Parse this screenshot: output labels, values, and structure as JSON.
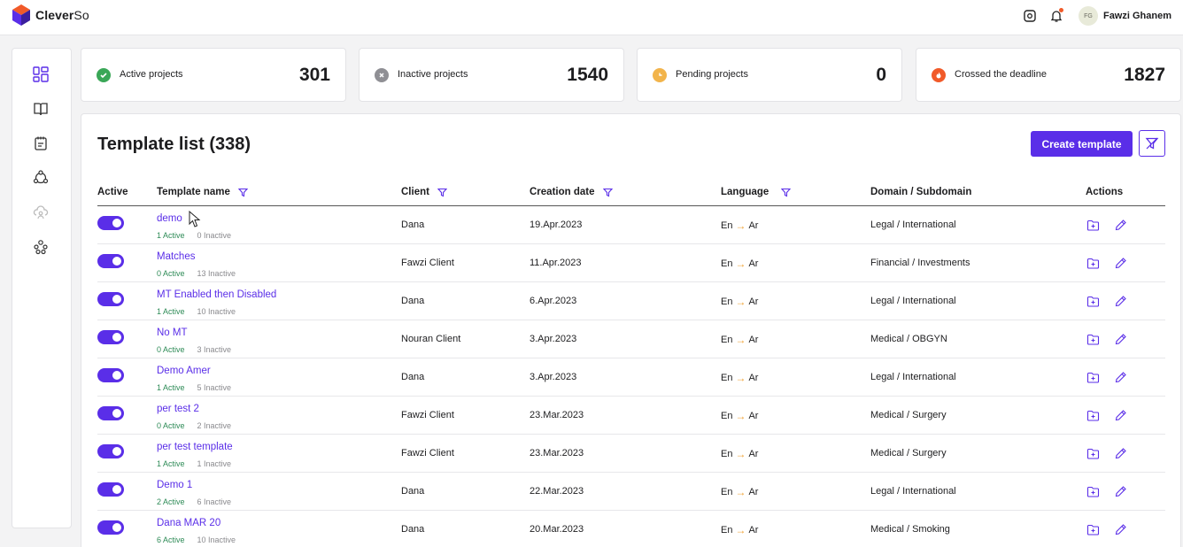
{
  "app": {
    "brand_bold": "Clever",
    "brand_light": "So"
  },
  "user": {
    "initials": "FG",
    "name": "Fawzi Ghanem"
  },
  "header_icons": [
    "settings-cog-icon",
    "bell-icon"
  ],
  "sidebar": {
    "items": [
      "dashboard-icon",
      "book-icon",
      "notebook-icon",
      "network-icon",
      "cloud-user-icon",
      "team-icon"
    ]
  },
  "stats": [
    {
      "label": "Active projects",
      "value": "301",
      "icon": "check-circle-icon",
      "color": "#3aa757"
    },
    {
      "label": "Inactive projects",
      "value": "1540",
      "icon": "x-circle-icon",
      "color": "#8f8f94"
    },
    {
      "label": "Pending projects",
      "value": "0",
      "icon": "clock-icon",
      "color": "#f2b44b"
    },
    {
      "label": "Crossed the deadline",
      "value": "1827",
      "icon": "flame-icon",
      "color": "#f15a29"
    }
  ],
  "panel": {
    "title": "Template list (338)",
    "create_label": "Create template"
  },
  "columns": {
    "active": "Active",
    "template_name": "Template name",
    "client": "Client",
    "creation_date": "Creation date",
    "language": "Language",
    "domain": "Domain / Subdomain",
    "actions": "Actions"
  },
  "rows": [
    {
      "name": "demo",
      "active": "1 Active",
      "inactive": "0 Inactive",
      "client": "Dana",
      "date": "19.Apr.2023",
      "src": "En",
      "tgt": "Ar",
      "domain": "Legal / International"
    },
    {
      "name": "Matches",
      "active": "0 Active",
      "inactive": "13 Inactive",
      "client": "Fawzi Client",
      "date": "11.Apr.2023",
      "src": "En",
      "tgt": "Ar",
      "domain": "Financial / Investments"
    },
    {
      "name": "MT Enabled then Disabled",
      "active": "1 Active",
      "inactive": "10 Inactive",
      "client": "Dana",
      "date": "6.Apr.2023",
      "src": "En",
      "tgt": "Ar",
      "domain": "Legal / International"
    },
    {
      "name": "No MT",
      "active": "0 Active",
      "inactive": "3 Inactive",
      "client": "Nouran Client",
      "date": "3.Apr.2023",
      "src": "En",
      "tgt": "Ar",
      "domain": "Medical / OBGYN"
    },
    {
      "name": "Demo Amer",
      "active": "1 Active",
      "inactive": "5 Inactive",
      "client": "Dana",
      "date": "3.Apr.2023",
      "src": "En",
      "tgt": "Ar",
      "domain": "Legal / International"
    },
    {
      "name": "per test 2",
      "active": "0 Active",
      "inactive": "2 Inactive",
      "client": "Fawzi Client",
      "date": "23.Mar.2023",
      "src": "En",
      "tgt": "Ar",
      "domain": "Medical / Surgery"
    },
    {
      "name": "per test template",
      "active": "1 Active",
      "inactive": "1 Inactive",
      "client": "Fawzi Client",
      "date": "23.Mar.2023",
      "src": "En",
      "tgt": "Ar",
      "domain": "Medical / Surgery"
    },
    {
      "name": "Demo 1",
      "active": "2 Active",
      "inactive": "6 Inactive",
      "client": "Dana",
      "date": "22.Mar.2023",
      "src": "En",
      "tgt": "Ar",
      "domain": "Legal / International"
    },
    {
      "name": "Dana MAR 20",
      "active": "6 Active",
      "inactive": "10 Inactive",
      "client": "Dana",
      "date": "20.Mar.2023",
      "src": "En",
      "tgt": "Ar",
      "domain": "Medical / Smoking"
    }
  ],
  "colors": {
    "accent": "#5a2ee8",
    "active_count": "#2e8b57",
    "language_arrow": "#f0a030"
  }
}
